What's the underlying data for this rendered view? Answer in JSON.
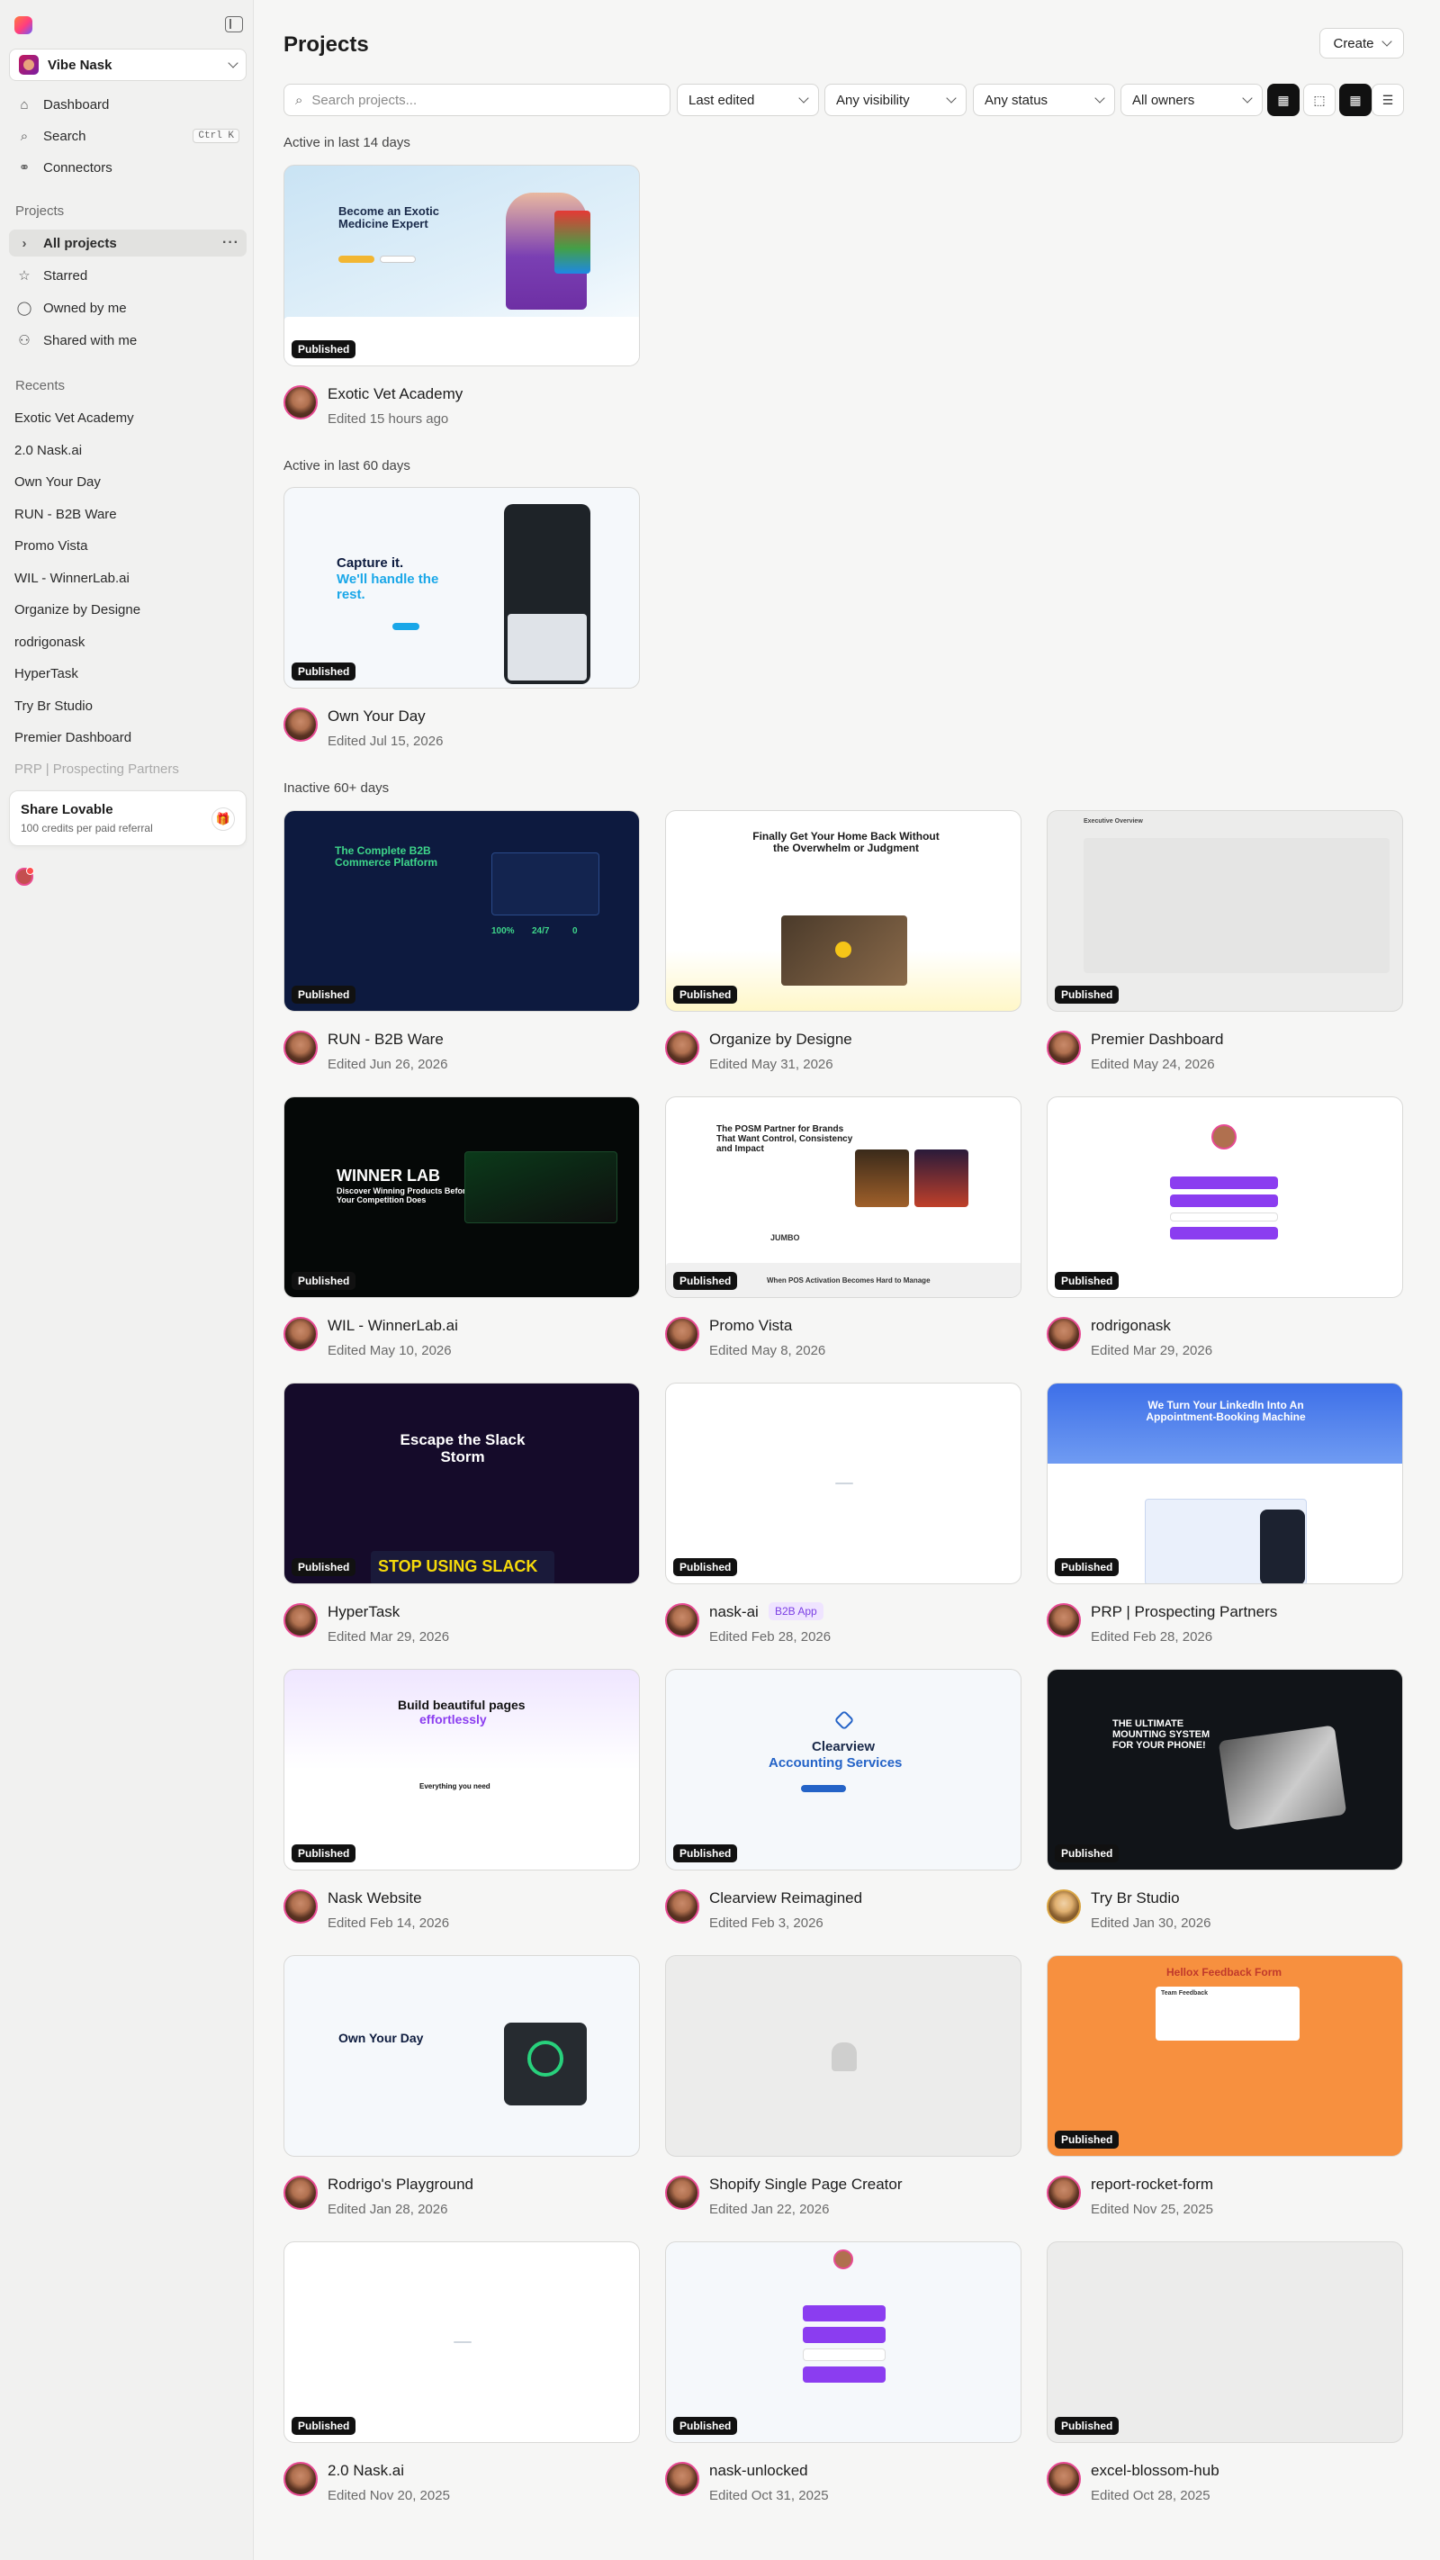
{
  "workspace": {
    "name": "Vibe Nask"
  },
  "nav": {
    "dashboard": "Dashboard",
    "search": "Search",
    "search_shortcut": "Ctrl K",
    "connectors": "Connectors"
  },
  "projects_section": {
    "title": "Projects",
    "all": "All projects",
    "starred": "Starred",
    "owned": "Owned by me",
    "shared": "Shared with me"
  },
  "recents": {
    "title": "Recents",
    "items": [
      "Exotic Vet Academy",
      "2.0 Nask.ai",
      "Own Your Day",
      "RUN - B2B Ware",
      "Promo Vista",
      "WIL - WinnerLab.ai",
      "Organize by Designe",
      "rodrigonask",
      "HyperTask",
      "Try Br Studio",
      "Premier Dashboard",
      "PRP | Prospecting Partners"
    ]
  },
  "share": {
    "title": "Share Lovable",
    "subtitle": "100 credits per paid referral"
  },
  "header": {
    "title": "Projects",
    "create": "Create"
  },
  "filters": {
    "search_placeholder": "Search projects...",
    "sort": "Last edited",
    "visibility": "Any visibility",
    "status": "Any status",
    "owners": "All owners"
  },
  "groups": {
    "g14": "Active in last 14 days",
    "g60": "Active in last 60 days",
    "g60plus": "Inactive 60+ days"
  },
  "badge_text": "Published",
  "projects": [
    {
      "name": "Exotic Vet Academy",
      "edited": "Edited 15 hours ago",
      "published": true
    },
    {
      "name": "Own Your Day",
      "edited": "Edited Jul 15, 2026",
      "published": true
    },
    {
      "name": "RUN - B2B Ware",
      "edited": "Edited Jun 26, 2026",
      "published": true
    },
    {
      "name": "Organize by Designe",
      "edited": "Edited May 31, 2026",
      "published": true
    },
    {
      "name": "Premier Dashboard",
      "edited": "Edited May 24, 2026",
      "published": true
    },
    {
      "name": "WIL - WinnerLab.ai",
      "edited": "Edited May 10, 2026",
      "published": true
    },
    {
      "name": "Promo Vista",
      "edited": "Edited May 8, 2026",
      "published": true
    },
    {
      "name": "rodrigonask",
      "edited": "Edited Mar 29, 2026",
      "published": true
    },
    {
      "name": "HyperTask",
      "edited": "Edited Mar 29, 2026",
      "published": true
    },
    {
      "name": "nask-ai",
      "edited": "Edited Feb 28, 2026",
      "published": true,
      "tag": "B2B App"
    },
    {
      "name": "PRP | Prospecting Partners",
      "edited": "Edited Feb 28, 2026",
      "published": true
    },
    {
      "name": "Nask Website",
      "edited": "Edited Feb 14, 2026",
      "published": true
    },
    {
      "name": "Clearview Reimagined",
      "edited": "Edited Feb 3, 2026",
      "published": true
    },
    {
      "name": "Try Br Studio",
      "edited": "Edited Jan 30, 2026",
      "published": true
    },
    {
      "name": "Rodrigo's Playground",
      "edited": "Edited Jan 28, 2026",
      "published": false
    },
    {
      "name": "Shopify Single Page Creator",
      "edited": "Edited Jan 22, 2026",
      "published": false
    },
    {
      "name": "report-rocket-form",
      "edited": "Edited Nov 25, 2025",
      "published": true
    },
    {
      "name": "2.0 Nask.ai",
      "edited": "Edited Nov 20, 2025",
      "published": true
    },
    {
      "name": "nask-unlocked",
      "edited": "Edited Oct 31, 2025",
      "published": true
    },
    {
      "name": "excel-blossom-hub",
      "edited": "Edited Oct 28, 2025",
      "published": true
    }
  ],
  "thumbs": {
    "vet_title": "Become an Exotic Medicine Expert",
    "own_title1": "Capture it.",
    "own_title2": "We'll handle the rest.",
    "b2b_title": "The Complete B2B Commerce Platform",
    "b2b_stats": [
      "100%",
      "24/7",
      "0"
    ],
    "organize_title": "Finally Get Your Home Back Without the Overwhelm or Judgment",
    "premier_title": "Executive Overview",
    "winner_title": "WINNER LAB",
    "winner_sub": "Discover Winning Products Before Your Competition Does",
    "promo_title": "The POSM Partner for Brands That Want Control, Consistency and Impact",
    "promo_brand": "JUMBO",
    "promo_footer": "When POS Activation Becomes Hard to Manage",
    "hyper_title": "Escape the Slack Storm",
    "hyper_banner": "STOP USING SLACK",
    "prp_title": "We Turn Your LinkedIn Into An Appointment-Booking Machine",
    "nask_title": "Build beautiful pages",
    "nask_title2": "effortlessly",
    "nask_sub": "Everything you need",
    "clear_title": "Clearview",
    "clear_title2": "Accounting Services",
    "trybr_title": "THE ULTIMATE MOUNTING SYSTEM FOR YOUR PHONE!",
    "playground_title": "Own Your Day",
    "report_title": "Hellox Feedback Form",
    "report_sub": "Team Feedback"
  }
}
